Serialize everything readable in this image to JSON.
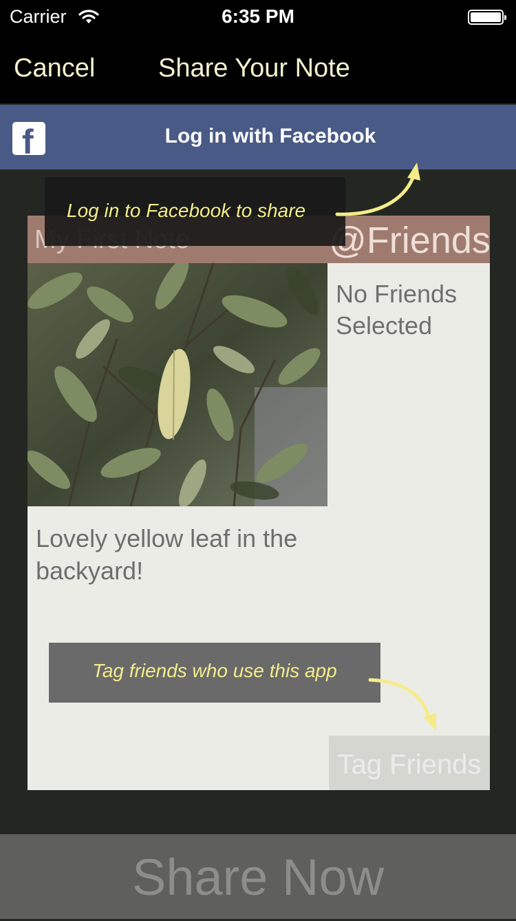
{
  "status_bar": {
    "carrier": "Carrier",
    "time": "6:35 PM",
    "icons": [
      "wifi-icon",
      "battery-icon"
    ]
  },
  "nav": {
    "cancel_label": "Cancel",
    "title": "Share Your Note"
  },
  "facebook": {
    "login_label": "Log in with Facebook",
    "logo_glyph": "f",
    "brand_color": "#4a5a86"
  },
  "note": {
    "title": "My First Note",
    "friends_header": "@Friends",
    "friends_status": "No Friends Selected",
    "caption": "Lovely yellow leaf in the backyard!",
    "tag_friends_label": "Tag Friends"
  },
  "tooltips": {
    "fb_hint": "Log in to Facebook to share",
    "tag_hint": "Tag friends who use this app",
    "color": "#f4ec8a"
  },
  "share": {
    "label": "Share Now"
  }
}
